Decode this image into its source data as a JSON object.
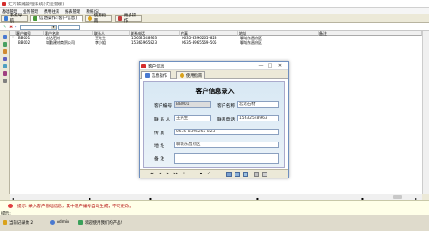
{
  "app": {
    "title": "汇可铁路管理系统(试运营版)"
  },
  "menu": [
    "基础管理",
    "业务管理",
    "费用往来",
    "报表管理",
    "系统(S)"
  ],
  "toolbar": {
    "tabs": [
      {
        "label": "系统导航",
        "icon": "navigation-icon"
      },
      {
        "label": "信息操作:[客户信息]",
        "icon": "info-icon"
      },
      {
        "label": "使用指南",
        "icon": "help-icon"
      },
      {
        "label": "更多操作",
        "icon": "more-icon"
      }
    ]
  },
  "grid": {
    "columns": [
      "客户编号",
      "客户名称",
      "联系人",
      "联系电话",
      "传真",
      "地址",
      "备注"
    ],
    "rows": [
      {
        "marker": "*",
        "cells": [
          "BB001",
          "宏达石材",
          "王先生",
          "15632548963",
          "0635-8396265-823",
          "聊城东昌府区",
          ""
        ]
      },
      {
        "marker": "",
        "cells": [
          "BB002",
          "和勤建材商贸公司",
          "李小姐",
          "15365965823",
          "0635-8965569-505",
          "聊城东昌府区",
          ""
        ]
      }
    ]
  },
  "dialog": {
    "title": "客户信息",
    "tabs": [
      "信息操作",
      "使用指南"
    ],
    "form_title": "客户信息录入",
    "fields": {
      "code_label": "客户编号",
      "code_value": "BB001",
      "name_label": "客户名称",
      "name_value": "宏达石材",
      "contact_label": "联 系 人",
      "contact_value": "王先生",
      "phone_label": "联系电话",
      "phone_value": "15632548963",
      "fax_label": "传    真",
      "fax_value": "0635-8396265-823",
      "address_label": "地    址",
      "address_value": "聊城东昌府区",
      "remark_label": "备    注",
      "remark_value": ""
    },
    "window_buttons": {
      "minimize": "—",
      "maximize": "□",
      "close": "✕"
    },
    "nav": [
      "◂◂",
      "◂",
      "▸",
      "▸▸",
      "+",
      "−",
      "▴",
      "✓"
    ]
  },
  "prompt": {
    "message": "提示: 录入客户基础信息，其中客户编号自动生成，不可更改。",
    "signature": "提示:"
  },
  "status": {
    "reminder": "当前记录数 2",
    "user": "Admin",
    "welcome": "欢迎使用我们的产品!"
  },
  "colors": {
    "accent": "#2f6fb5",
    "prompt_text": "#b00000",
    "form_bg": "#dbe9f5"
  }
}
